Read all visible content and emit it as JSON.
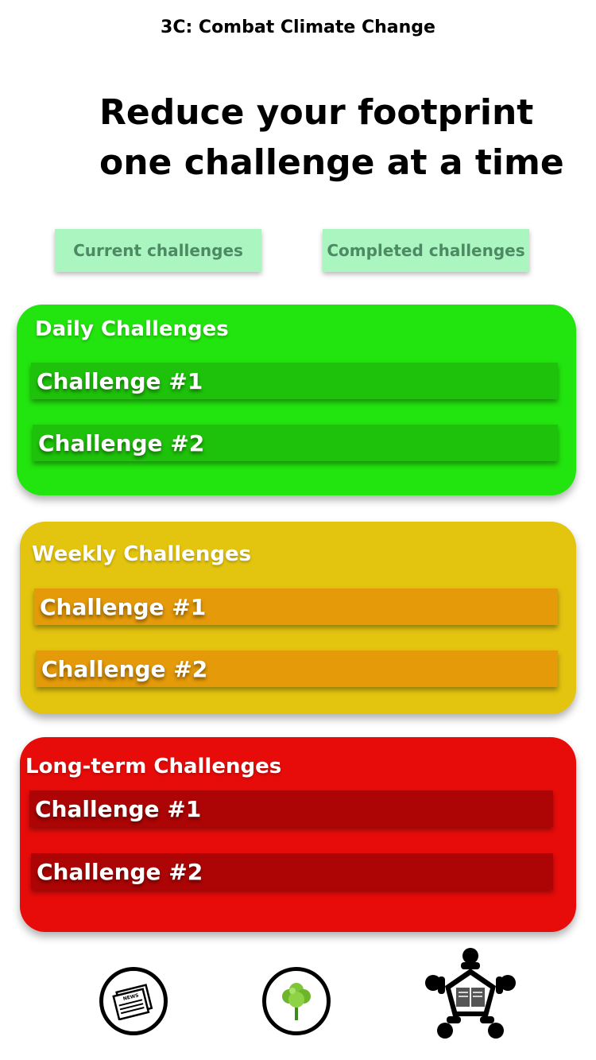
{
  "app": {
    "title": "3C: Combat Climate Change"
  },
  "hero": {
    "line1": "Reduce your footprint",
    "line2": "one challenge at a time"
  },
  "tabs": {
    "current_label": "Current challenges",
    "completed_label": "Completed challenges"
  },
  "sections": {
    "daily": {
      "title": "Daily Challenges",
      "items": [
        "Challenge #1",
        "Challenge #2"
      ]
    },
    "weekly": {
      "title": "Weekly Challenges",
      "items": [
        "Challenge #1",
        "Challenge #2"
      ]
    },
    "longterm": {
      "title": "Long-term Challenges",
      "items": [
        "Challenge #1",
        "Challenge #2"
      ]
    }
  },
  "nav": {
    "news_icon_text": "NEWS",
    "items": [
      "news-icon",
      "tree-icon",
      "community-icon"
    ]
  },
  "colors": {
    "daily": "#22e40e",
    "weekly": "#e3c40f",
    "longterm": "#e70c0a",
    "tab_button": "#aaf5c0"
  }
}
